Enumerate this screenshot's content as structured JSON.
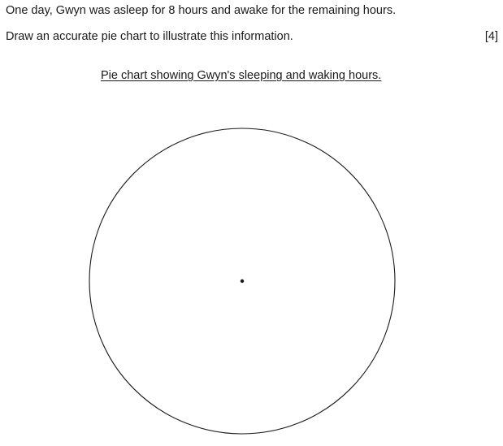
{
  "question": {
    "line1": "One day, Gwyn was asleep for 8 hours and awake for the remaining hours.",
    "line2": "Draw an accurate pie chart to illustrate this information.",
    "marks": "[4]"
  },
  "pie": {
    "title": "Pie chart showing Gwyn's sleeping and waking hours.",
    "stroke_color": "#1a1a1a",
    "fill_color": "#ffffff"
  }
}
